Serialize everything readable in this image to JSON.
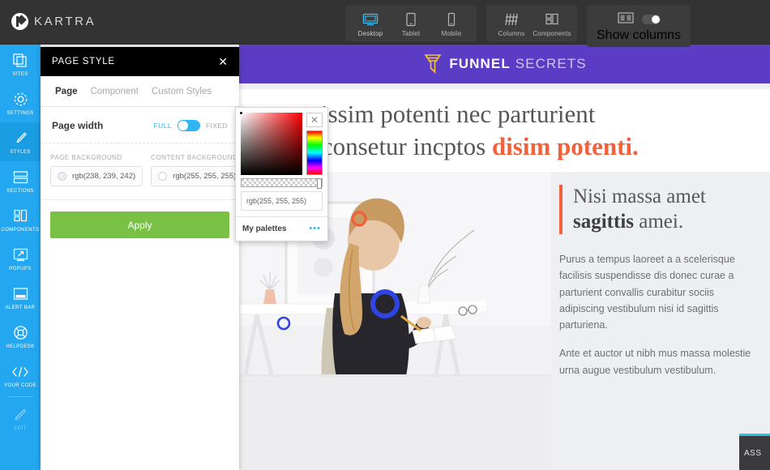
{
  "topbar": {
    "brand": "KARTRA",
    "brand_icon": "kartra-k-logo-icon",
    "groups": [
      {
        "name": "device-group",
        "buttons": [
          {
            "label": "Desktop",
            "icon": "desktop-monitor-icon",
            "active": true
          },
          {
            "label": "Tablet",
            "icon": "tablet-icon",
            "active": false
          },
          {
            "label": "Mobile",
            "icon": "mobile-phone-icon",
            "active": false
          }
        ]
      },
      {
        "name": "layout-group",
        "buttons": [
          {
            "label": "Columns",
            "icon": "grid-columns-icon",
            "active": false
          },
          {
            "label": "Components",
            "icon": "components-blocks-icon",
            "active": false
          }
        ]
      }
    ],
    "show_columns": {
      "label": "Show columns",
      "icon": "two-column-icon",
      "toggle_on": true
    }
  },
  "sidebar": {
    "items": [
      {
        "label": "SITES",
        "icon": "stacked-pages-icon",
        "active": false,
        "dim": false
      },
      {
        "label": "SETTINGS",
        "icon": "gear-icon",
        "active": false,
        "dim": false
      },
      {
        "label": "STYLES",
        "icon": "paintbrush-icon",
        "active": true,
        "dim": false
      },
      {
        "label": "SECTIONS",
        "icon": "sections-rows-icon",
        "active": false,
        "dim": false
      },
      {
        "label": "COMPONENTS",
        "icon": "components-blocks-icon",
        "active": false,
        "dim": false
      },
      {
        "label": "POPUPS",
        "icon": "popup-window-icon",
        "active": false,
        "dim": false
      },
      {
        "label": "ALERT BAR",
        "icon": "alert-bar-icon",
        "active": false,
        "dim": false
      },
      {
        "label": "HELPDESK",
        "icon": "lifebuoy-icon",
        "active": false,
        "dim": false
      },
      {
        "label": "YOUR CODE",
        "icon": "code-brackets-icon",
        "active": false,
        "dim": false
      },
      {
        "label": "EDIT",
        "icon": "pencil-icon",
        "active": false,
        "dim": true
      }
    ]
  },
  "panel": {
    "title": "PAGE STYLE",
    "close_icon": "close-icon",
    "tabs": [
      {
        "label": "Page",
        "active": true
      },
      {
        "label": "Component",
        "active": false
      },
      {
        "label": "Custom Styles",
        "active": false
      }
    ],
    "page_width": {
      "label": "Page width",
      "option_left": "FULL",
      "option_right": "FIXED",
      "selected": "FULL"
    },
    "backgrounds": [
      {
        "caption": "PAGE BACKGROUND",
        "value": "rgb(238, 239, 242)",
        "swatch": "#eeeff2"
      },
      {
        "caption": "CONTENT BACKGROUND",
        "value": "rgb(255, 255, 255)",
        "swatch": "#ffffff"
      }
    ],
    "apply_label": "Apply",
    "apply_color": "#79c144"
  },
  "color_picker": {
    "close_icon": "close-icon",
    "hex_value": "rgb(255, 255, 255)",
    "palettes_label": "My palettes",
    "palettes_menu_icon": "more-dots-icon",
    "hue": "#ff0000",
    "accent": "#2fb6f0"
  },
  "canvas": {
    "banner": {
      "brand_bold": "FUNNEL",
      "brand_light": "SECRETS",
      "icon": "funnel-icon",
      "bg_color": "#5b3cc4"
    },
    "hero": {
      "line1": "gnissim potenti nec parturient",
      "line2_plain": "ip consetur incptos ",
      "line2_accent": "disim potenti.",
      "accent_color": "#f0613c"
    },
    "feature": {
      "heading_line1": "Nisi massa amet",
      "heading_bold": "sagittis",
      "heading_rest": " amei.",
      "paragraph1": "Purus a tempus laoreet a a scelerisque facilisis suspendisse dis donec curae a parturient convallis curabitur sociis adipiscing vestibulum nisi id sagittis parturiena.",
      "paragraph2": "Ante et auctor ut nibh mus massa molestie urna augue vestibulum vestibulum.",
      "accent_bar_color": "#f0613c"
    },
    "photo": {
      "alt": "woman-at-desk-illustration",
      "decor": [
        "orange-square-outline",
        "orange-circle-outline",
        "blue-circle-outline",
        "blue-small-circle-outline"
      ]
    }
  },
  "assistant_badge": {
    "label": "ASS",
    "accent": "#2ec4e6"
  }
}
